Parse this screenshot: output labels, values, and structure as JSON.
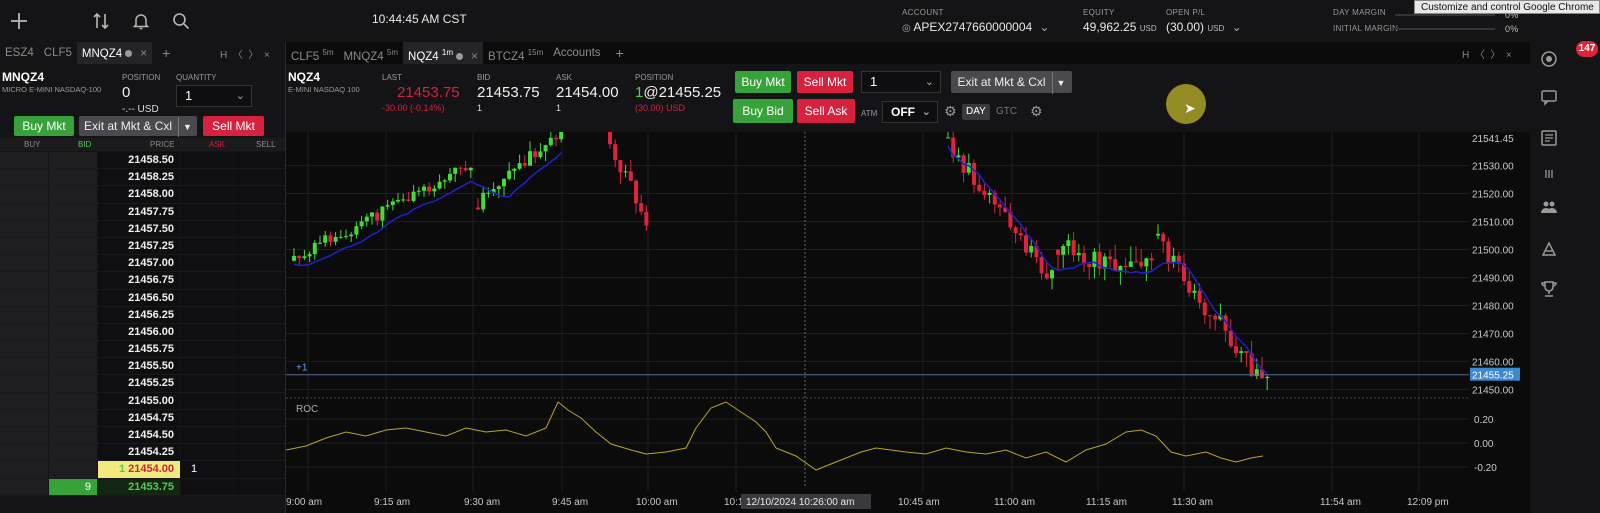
{
  "topbar": {
    "clock": "10:44:45 AM CST",
    "account_label": "ACCOUNT",
    "account_value": "APEX2747660000004",
    "equity_label": "EQUITY",
    "equity_value": "49,962.25",
    "equity_unit": "USD",
    "open_pl_label": "OPEN P/L",
    "open_pl_value": "(30.00)",
    "open_pl_unit": "USD",
    "day_margin_label": "DAY MARGIN",
    "initial_margin_label": "INITIAL MARGIN",
    "margin_pct_1": "0%",
    "margin_pct_2": "0%",
    "tooltip": "Customize and control Google Chrome",
    "notification_count": "147"
  },
  "left_panel": {
    "tabs": [
      {
        "label": "ESZ4",
        "active": false
      },
      {
        "label": "CLF5",
        "active": false
      },
      {
        "label": "MNQZ4",
        "active": true
      }
    ],
    "symbol": "MNQZ4",
    "description": "MICRO E-MINI NASDAQ-100",
    "position_label": "POSITION",
    "position_value": "0",
    "position_sub": "-.-- USD",
    "quantity_label": "QUANTITY",
    "quantity_value": "1",
    "buy_mkt": "Buy Mkt",
    "exit_cxl": "Exit at Mkt & Cxl",
    "sell_mkt": "Sell Mkt",
    "col_buy": "BUY",
    "col_bid": "BID",
    "col_price": "PRICE",
    "col_ask": "ASK",
    "col_sell": "SELL",
    "ladder": [
      {
        "price": "21458.50"
      },
      {
        "price": "21458.25"
      },
      {
        "price": "21458.00"
      },
      {
        "price": "21457.75"
      },
      {
        "price": "21457.50"
      },
      {
        "price": "21457.25"
      },
      {
        "price": "21457.00"
      },
      {
        "price": "21456.75"
      },
      {
        "price": "21456.50"
      },
      {
        "price": "21456.25"
      },
      {
        "price": "21456.00"
      },
      {
        "price": "21455.75"
      },
      {
        "price": "21455.50"
      },
      {
        "price": "21455.25"
      },
      {
        "price": "21455.00"
      },
      {
        "price": "21454.75"
      },
      {
        "price": "21454.50"
      },
      {
        "price": "21454.25"
      },
      {
        "price": "21454.00",
        "marker": "1",
        "ask_size": "1",
        "type": "hl"
      },
      {
        "price": "21453.75",
        "bid_size": "9",
        "type": "bid"
      }
    ]
  },
  "chart_panel": {
    "tabs": [
      {
        "label": "CLF5",
        "sup": "5m",
        "active": false
      },
      {
        "label": "MNQZ4",
        "sup": "5m",
        "active": false
      },
      {
        "label": "NQZ4",
        "sup": "1m",
        "active": true
      },
      {
        "label": "BTCZ4",
        "sup": "15m",
        "active": false
      },
      {
        "label": "Accounts",
        "sup": "",
        "active": false
      }
    ],
    "symbol": "NQZ4",
    "description": "E-MINI NASDAQ 100",
    "last_label": "LAST",
    "last_value": "21453.75",
    "last_change": "-30.00 (-0.14%)",
    "bid_label": "BID",
    "bid_value": "21453.75",
    "bid_size": "1",
    "ask_label": "ASK",
    "ask_value": "21454.00",
    "ask_size": "1",
    "position_label": "POSITION",
    "position_qty": "1",
    "position_value": "@21455.25",
    "position_pl": "(30.00) USD",
    "buy_mkt": "Buy Mkt",
    "sell_mkt": "Sell Mkt",
    "buy_bid": "Buy Bid",
    "sell_ask": "Sell Ask",
    "qty_value": "1",
    "exit_cxl": "Exit at Mkt & Cxl",
    "atm_label": "ATM",
    "atm_value": "OFF",
    "day_label": "DAY",
    "gtc_label": "GTC",
    "position_marker": "+1",
    "roc_label": "ROC",
    "crosshair_time": "12/10/2024 10:26:00 am"
  },
  "chart_data": {
    "type": "candlestick",
    "price_ticks": [
      "21541.45",
      "21530.00",
      "21520.00",
      "21510.00",
      "21500.00",
      "21490.00",
      "21480.00",
      "21470.00",
      "21460.00",
      "21455.25",
      "21450.00"
    ],
    "price_range": [
      21448,
      21542
    ],
    "roc_ticks": [
      "0.20",
      "0.00",
      "-0.20"
    ],
    "time_ticks": [
      "9:00 am",
      "9:15 am",
      "9:30 am",
      "9:45 am",
      "10:00 am",
      "10:1",
      "10:45 am",
      "11:00 am",
      "11:15 am",
      "11:30 am",
      "11:54 am",
      "12:09 pm"
    ],
    "position_line": 21455.25,
    "colors": {
      "up": "#3fdc3a",
      "down": "#e0233a",
      "ma": "#1f22c8",
      "roc": "#b9a52a"
    },
    "grid": true
  }
}
